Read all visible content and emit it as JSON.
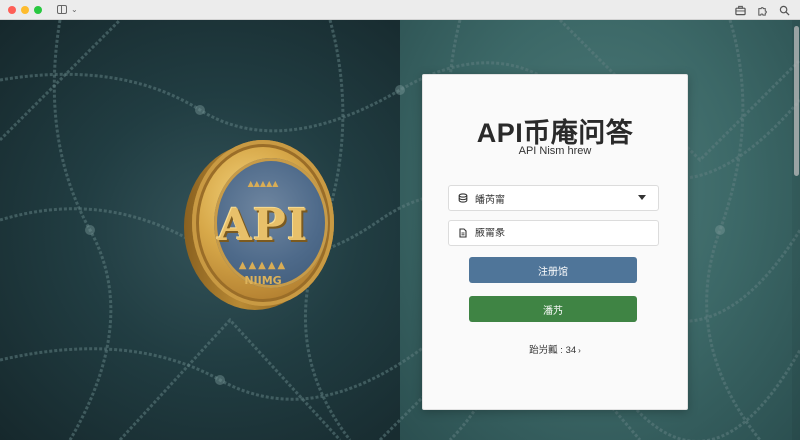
{
  "browser": {
    "icons": [
      "sidebar-icon",
      "chevron-down-icon",
      "briefcase-icon",
      "extension-icon",
      "search-icon"
    ],
    "chevron_glyph": "⌄"
  },
  "hero": {
    "coin_text": "API",
    "coin_subtext": "NIIMG",
    "coin_deco": "▲▲▲▲▲"
  },
  "login": {
    "title": "API币庵问答",
    "subtitle": "API Nism hrew",
    "select_value": "皤芮甯",
    "input_placeholder": "腋甯彖",
    "register_label": "注册馆",
    "login_label": "潘艿",
    "footer_text": "跆屶瓤 : 34",
    "footer_arrow": "›"
  },
  "colors": {
    "register_button": "#4f7599",
    "login_button": "#3f8444",
    "background_left": "#213d42",
    "background_right": "#3c6867",
    "coin_gold": "#d7a849"
  }
}
